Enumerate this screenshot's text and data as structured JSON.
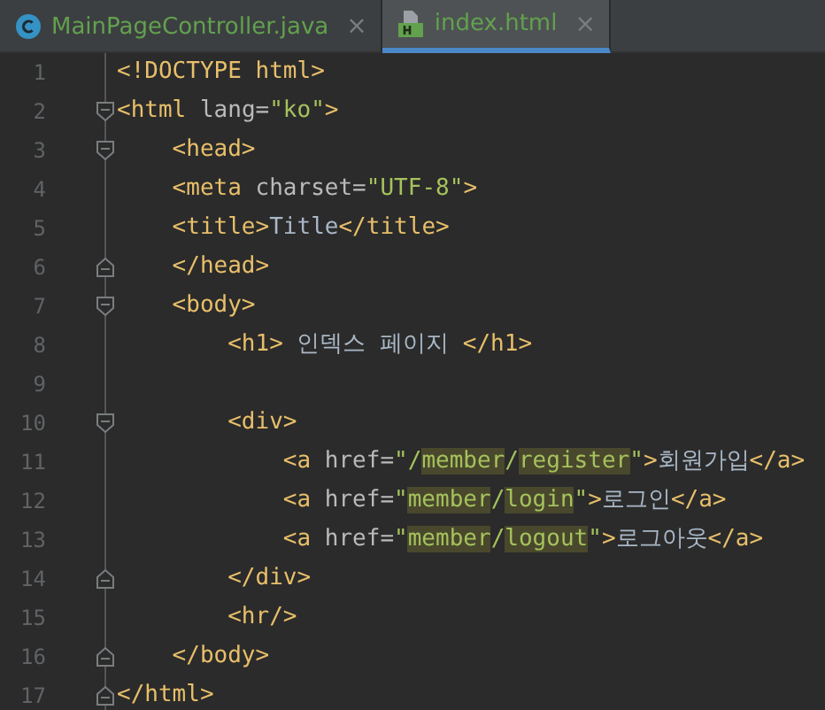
{
  "tabs": [
    {
      "label": "MainPageController.java",
      "kind": "java",
      "close": "×",
      "selected": false
    },
    {
      "label": "index.html",
      "kind": "html",
      "close": "×",
      "selected": true
    }
  ],
  "lines": [
    {
      "number": "1",
      "tokens": [
        {
          "kind": "tag",
          "text": "<!DOCTYPE html>"
        }
      ]
    },
    {
      "number": "2",
      "kind": "fold-start",
      "tokens": [
        {
          "kind": "tag",
          "text": "<html "
        },
        {
          "kind": "attr",
          "text": "lang="
        },
        {
          "kind": "str",
          "text": "\"ko\""
        },
        {
          "kind": "tag",
          "text": ">"
        }
      ],
      "children": [
        {
          "number": "3",
          "kind": "fold-start",
          "tokens": [
            {
              "kind": "tag",
              "text": "<head>"
            }
          ]
        },
        {
          "number": "4",
          "tokens": [
            {
              "kind": "tag",
              "text": "<meta "
            },
            {
              "kind": "attr",
              "text": "charset="
            },
            {
              "kind": "str",
              "text": "\"UTF-8\""
            },
            {
              "kind": "tag",
              "text": ">"
            }
          ]
        },
        {
          "number": "5",
          "tokens": [
            {
              "kind": "tag",
              "text": "<title>"
            },
            {
              "kind": "text",
              "text": "Title"
            },
            {
              "kind": "tag",
              "text": "</title>"
            }
          ]
        },
        {
          "number": "6",
          "kind": "fold-end",
          "tokens": [
            {
              "kind": "tag",
              "text": "</head>"
            }
          ]
        },
        {
          "number": "7",
          "kind": "fold-start",
          "tokens": [
            {
              "kind": "tag",
              "text": "<body>"
            }
          ],
          "children": [
            {
              "number": "8",
              "tokens": [
                {
                  "kind": "tag",
                  "text": "<h1>"
                },
                {
                  "kind": "text",
                  "text": " 인덱스 페이지 "
                },
                {
                  "kind": "tag",
                  "text": "</h1>"
                }
              ]
            },
            {
              "number": "9"
            },
            {
              "number": "10",
              "kind": "fold-start",
              "tokens": [
                {
                  "kind": "tag",
                  "text": "<div>"
                }
              ],
              "children": [
                {
                  "number": "11",
                  "tokens": [
                    {
                      "kind": "tag",
                      "text": "<a "
                    },
                    {
                      "kind": "attr",
                      "text": "href="
                    },
                    {
                      "kind": "str",
                      "text": "\"/"
                    },
                    {
                      "kind": "str",
                      "text": "member",
                      "highlight": true
                    },
                    {
                      "kind": "str",
                      "text": "/"
                    },
                    {
                      "kind": "str",
                      "text": "register",
                      "highlight": true
                    },
                    {
                      "kind": "str",
                      "text": "\""
                    },
                    {
                      "kind": "tag",
                      "text": ">"
                    },
                    {
                      "kind": "text",
                      "text": "회원가입"
                    },
                    {
                      "kind": "tag",
                      "text": "</a>"
                    }
                  ]
                },
                {
                  "number": "12",
                  "tokens": [
                    {
                      "kind": "tag",
                      "text": "<a "
                    },
                    {
                      "kind": "attr",
                      "text": "href="
                    },
                    {
                      "kind": "str",
                      "text": "\""
                    },
                    {
                      "kind": "str",
                      "text": "member",
                      "highlight": true
                    },
                    {
                      "kind": "str",
                      "text": "/"
                    },
                    {
                      "kind": "str",
                      "text": "login",
                      "highlight": true
                    },
                    {
                      "kind": "str",
                      "text": "\""
                    },
                    {
                      "kind": "tag",
                      "text": ">"
                    },
                    {
                      "kind": "text",
                      "text": "로그인"
                    },
                    {
                      "kind": "tag",
                      "text": "</a>"
                    }
                  ]
                },
                {
                  "number": "13",
                  "tokens": [
                    {
                      "kind": "tag",
                      "text": "<a "
                    },
                    {
                      "kind": "attr",
                      "text": "href="
                    },
                    {
                      "kind": "str",
                      "text": "\""
                    },
                    {
                      "kind": "str",
                      "text": "member",
                      "highlight": true
                    },
                    {
                      "kind": "str",
                      "text": "/"
                    },
                    {
                      "kind": "str",
                      "text": "logout",
                      "highlight": true
                    },
                    {
                      "kind": "str",
                      "text": "\""
                    },
                    {
                      "kind": "tag",
                      "text": ">"
                    },
                    {
                      "kind": "text",
                      "text": "로그아웃"
                    },
                    {
                      "kind": "tag",
                      "text": "</a>"
                    }
                  ]
                }
              ]
            },
            {
              "number": "14",
              "kind": "fold-end",
              "tokens": [
                {
                  "kind": "tag",
                  "text": "</div>"
                }
              ]
            },
            {
              "number": "15",
              "tokens": [
                {
                  "kind": "tag",
                  "text": "<hr/>"
                }
              ]
            }
          ]
        },
        {
          "number": "16",
          "kind": "fold-end",
          "tokens": [
            {
              "kind": "tag",
              "text": "</body>"
            }
          ]
        }
      ]
    },
    {
      "number": "17",
      "kind": "fold-end",
      "tokens": [
        {
          "kind": "tag",
          "text": "</html>"
        }
      ]
    }
  ]
}
